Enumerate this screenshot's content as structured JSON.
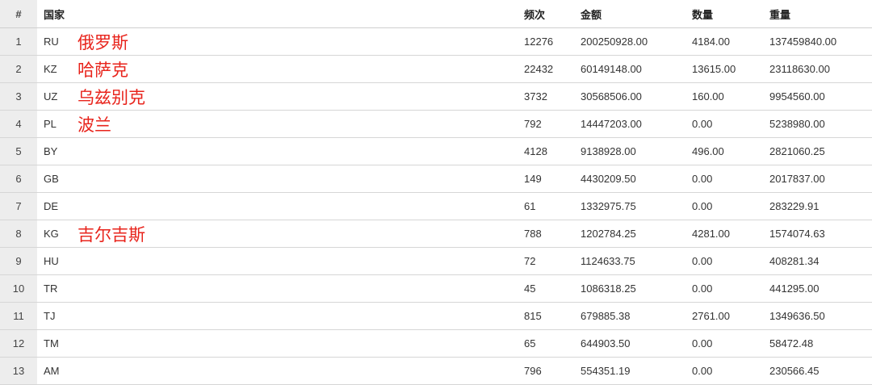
{
  "columns": {
    "index": "#",
    "country": "国家",
    "frequency": "频次",
    "amount": "金额",
    "quantity": "数量",
    "weight": "重量"
  },
  "rows": [
    {
      "index": "1",
      "country": "RU",
      "note": "俄罗斯",
      "frequency": "12276",
      "amount": "200250928.00",
      "quantity": "4184.00",
      "weight": "137459840.00"
    },
    {
      "index": "2",
      "country": "KZ",
      "note": "哈萨克",
      "frequency": "22432",
      "amount": "60149148.00",
      "quantity": "13615.00",
      "weight": "23118630.00"
    },
    {
      "index": "3",
      "country": "UZ",
      "note": "乌兹别克",
      "frequency": "3732",
      "amount": "30568506.00",
      "quantity": "160.00",
      "weight": "9954560.00"
    },
    {
      "index": "4",
      "country": "PL",
      "note": "波兰",
      "frequency": "792",
      "amount": "14447203.00",
      "quantity": "0.00",
      "weight": "5238980.00"
    },
    {
      "index": "5",
      "country": "BY",
      "note": "",
      "frequency": "4128",
      "amount": "9138928.00",
      "quantity": "496.00",
      "weight": "2821060.25"
    },
    {
      "index": "6",
      "country": "GB",
      "note": "",
      "frequency": "149",
      "amount": "4430209.50",
      "quantity": "0.00",
      "weight": "2017837.00"
    },
    {
      "index": "7",
      "country": "DE",
      "note": "",
      "frequency": "61",
      "amount": "1332975.75",
      "quantity": "0.00",
      "weight": "283229.91"
    },
    {
      "index": "8",
      "country": "KG",
      "note": "吉尔吉斯",
      "frequency": "788",
      "amount": "1202784.25",
      "quantity": "4281.00",
      "weight": "1574074.63"
    },
    {
      "index": "9",
      "country": "HU",
      "note": "",
      "frequency": "72",
      "amount": "1124633.75",
      "quantity": "0.00",
      "weight": "408281.34"
    },
    {
      "index": "10",
      "country": "TR",
      "note": "",
      "frequency": "45",
      "amount": "1086318.25",
      "quantity": "0.00",
      "weight": "441295.00"
    },
    {
      "index": "11",
      "country": "TJ",
      "note": "",
      "frequency": "815",
      "amount": "679885.38",
      "quantity": "2761.00",
      "weight": "1349636.50"
    },
    {
      "index": "12",
      "country": "TM",
      "note": "",
      "frequency": "65",
      "amount": "644903.50",
      "quantity": "0.00",
      "weight": "58472.48"
    },
    {
      "index": "13",
      "country": "AM",
      "note": "",
      "frequency": "796",
      "amount": "554351.19",
      "quantity": "0.00",
      "weight": "230566.45"
    }
  ],
  "colors": {
    "annotation": "#e8231b",
    "index_column_bg": "#ededed",
    "row_border": "#d6d6d6"
  }
}
